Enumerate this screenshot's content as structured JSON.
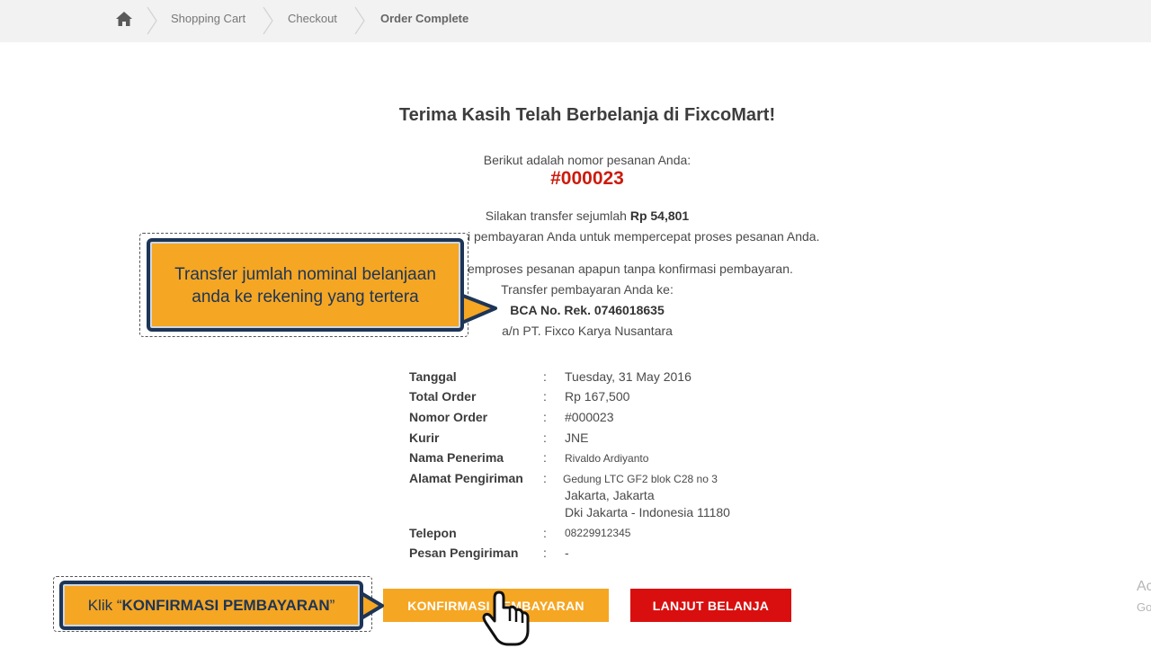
{
  "breadcrumb": {
    "home_icon": "home-icon",
    "items": [
      "Shopping Cart",
      "Checkout",
      "Order Complete"
    ]
  },
  "title": "Terima Kasih Telah Berbelanja di FixcoMart!",
  "order_intro": "Berikut adalah nomor pesanan Anda:",
  "order_number": "#000023",
  "transfer": {
    "prefix": "Silakan transfer sejumlah",
    "amount": "Rp 54,801",
    "confirm_line": "i pembayaran Anda untuk mempercepat proses pesanan Anda.",
    "process_line": "emproses pesanan apapun tanpa konfirmasi pembayaran.",
    "to_label": "Transfer pembayaran Anda ke:",
    "account": "BCA No. Rek. 0746018635",
    "account_name": "a/n PT. Fixco Karya Nusantara"
  },
  "details": {
    "colon": ":",
    "tanggal": {
      "label": "Tanggal",
      "value": "Tuesday, 31 May 2016"
    },
    "total": {
      "label": "Total Order",
      "value": "Rp 167,500"
    },
    "nomor": {
      "label": "Nomor Order",
      "value": "#000023"
    },
    "kurir": {
      "label": "Kurir",
      "value": "JNE"
    },
    "penerima": {
      "label": "Nama Penerima",
      "value": "Rivaldo Ardiyanto"
    },
    "alamat": {
      "label": "Alamat Pengiriman",
      "line1": "Gedung LTC GF2 blok C28 no 3",
      "line2": "Jakarta, Jakarta",
      "line3": "Dki Jakarta - Indonesia 11180"
    },
    "telepon": {
      "label": "Telepon",
      "value": "08229912345"
    },
    "pesan": {
      "label": "Pesan Pengiriman",
      "value": "-"
    }
  },
  "buttons": {
    "confirm": "KONFIRMASI PEMBAYARAN",
    "continue": "LANJUT BELANJA"
  },
  "callouts": {
    "transfer_line1": "Transfer jumlah nominal belanjaan",
    "transfer_line2": "anda ke rekening yang tertera",
    "click_prefix": "Klik “ ",
    "click_bold": "KONFIRMASI PEMBAYARAN",
    "click_suffix": "”"
  },
  "watermark": {
    "line1": "Ac",
    "line2": "Go"
  },
  "colors": {
    "accent_orange": "#f5a623",
    "accent_red": "#d90f0f",
    "order_red": "#cc1b0d",
    "callout_border": "#1d3557"
  }
}
